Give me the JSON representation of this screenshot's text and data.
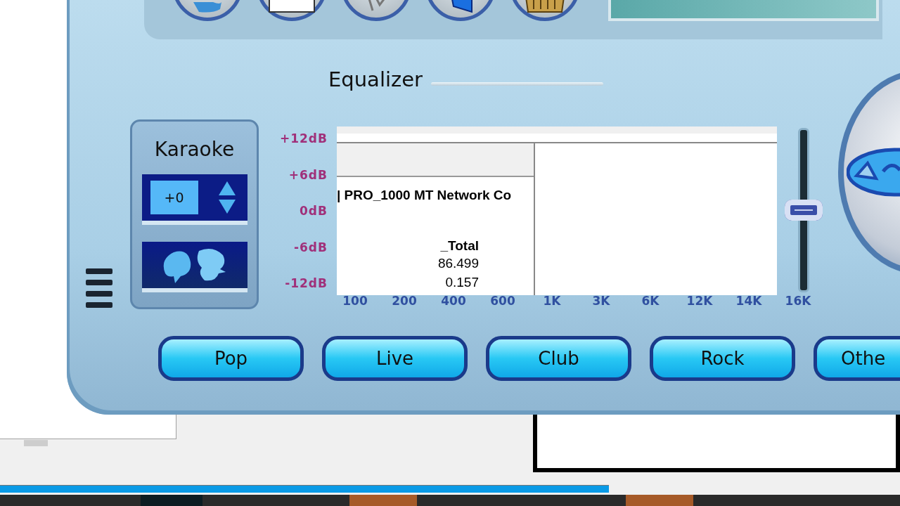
{
  "equalizer": {
    "title": "Equalizer",
    "db_labels": [
      "+12dB",
      "+6dB",
      "0dB",
      "-6dB",
      "-12dB"
    ],
    "frequencies": [
      "100",
      "200",
      "400",
      "600",
      "1K",
      "3K",
      "6K",
      "12K",
      "14K",
      "16K"
    ],
    "slider": {
      "level": 0.5
    }
  },
  "karaoke": {
    "title": "Karaoke",
    "value": "+0"
  },
  "presets": [
    "Pop",
    "Live",
    "Club",
    "Rock",
    "Othe"
  ],
  "overlay_window": {
    "header": "| PRO_1000 MT Network Co",
    "instance": "_Total",
    "values": [
      "86.499",
      "0.157"
    ]
  }
}
